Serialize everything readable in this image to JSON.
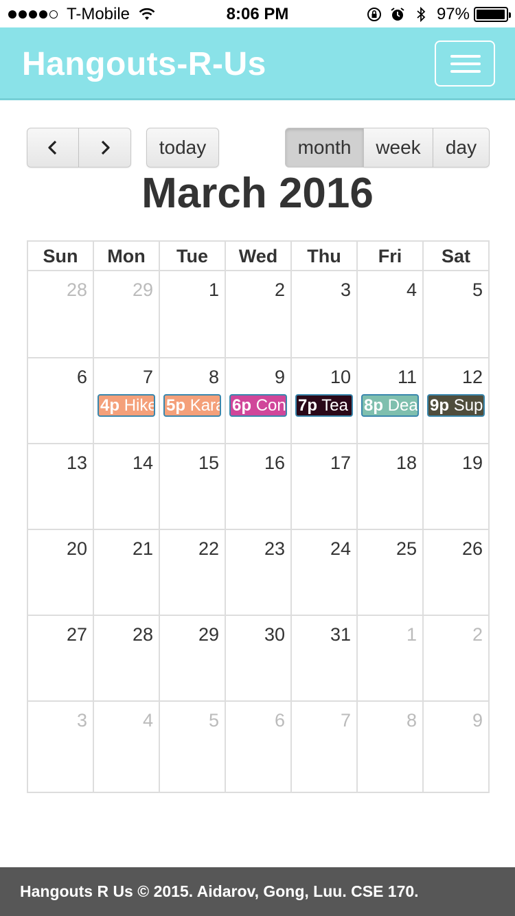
{
  "status_bar": {
    "carrier": "T-Mobile",
    "time": "8:06 PM",
    "battery_percent": "97%",
    "battery_level": 0.97,
    "signal_bars": 4,
    "signal_total": 5
  },
  "navbar": {
    "brand": "Hangouts-R-Us",
    "menu_icon": "hamburger-menu-icon",
    "background": "#8ae2e8"
  },
  "toolbar": {
    "prev_icon": "chevron-left-icon",
    "next_icon": "chevron-right-icon",
    "today_label": "today",
    "views": {
      "month": "month",
      "week": "week",
      "day": "day"
    },
    "active_view": "month"
  },
  "calendar": {
    "title": "March 2016",
    "weekdays": [
      "Sun",
      "Mon",
      "Tue",
      "Wed",
      "Thu",
      "Fri",
      "Sat"
    ],
    "weeks": [
      [
        {
          "day": "28",
          "other": true
        },
        {
          "day": "29",
          "other": true
        },
        {
          "day": "1"
        },
        {
          "day": "2"
        },
        {
          "day": "3"
        },
        {
          "day": "4"
        },
        {
          "day": "5"
        }
      ],
      [
        {
          "day": "6"
        },
        {
          "day": "7",
          "event": {
            "time": "4p",
            "title": "Hike",
            "color": "#f4a07a"
          }
        },
        {
          "day": "8",
          "event": {
            "time": "5p",
            "title": "Kara",
            "color": "#f4a07a"
          }
        },
        {
          "day": "9",
          "event": {
            "time": "6p",
            "title": "Con",
            "color": "#d0469a"
          }
        },
        {
          "day": "10",
          "event": {
            "time": "7p",
            "title": "Tea",
            "color": "#2a0818"
          }
        },
        {
          "day": "11",
          "event": {
            "time": "8p",
            "title": "Dea",
            "color": "#7fbfae"
          }
        },
        {
          "day": "12",
          "event": {
            "time": "9p",
            "title": "Sup",
            "color": "#4f4d3c"
          }
        }
      ],
      [
        {
          "day": "13"
        },
        {
          "day": "14"
        },
        {
          "day": "15"
        },
        {
          "day": "16"
        },
        {
          "day": "17"
        },
        {
          "day": "18"
        },
        {
          "day": "19"
        }
      ],
      [
        {
          "day": "20"
        },
        {
          "day": "21"
        },
        {
          "day": "22"
        },
        {
          "day": "23"
        },
        {
          "day": "24"
        },
        {
          "day": "25"
        },
        {
          "day": "26"
        }
      ],
      [
        {
          "day": "27"
        },
        {
          "day": "28"
        },
        {
          "day": "29"
        },
        {
          "day": "30"
        },
        {
          "day": "31"
        },
        {
          "day": "1",
          "other": true
        },
        {
          "day": "2",
          "other": true
        }
      ],
      [
        {
          "day": "3",
          "other": true
        },
        {
          "day": "4",
          "other": true
        },
        {
          "day": "5",
          "other": true
        },
        {
          "day": "6",
          "other": true
        },
        {
          "day": "7",
          "other": true
        },
        {
          "day": "8",
          "other": true
        },
        {
          "day": "9",
          "other": true
        }
      ]
    ]
  },
  "footer": {
    "text": "Hangouts R Us © 2015. Aidarov, Gong, Luu. CSE 170."
  }
}
